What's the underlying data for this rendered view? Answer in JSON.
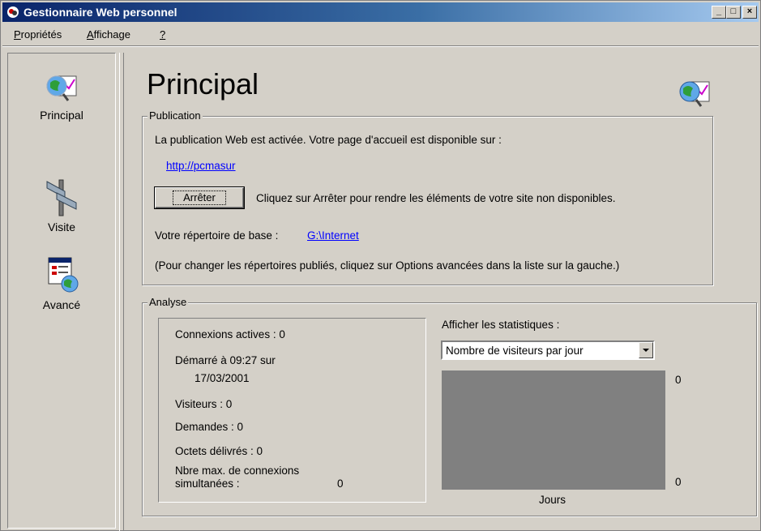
{
  "window": {
    "title": "Gestionnaire Web personnel",
    "controls": {
      "minimize": "_",
      "maximize": "□",
      "close": "×"
    }
  },
  "menu": [
    {
      "label": "Propriétés",
      "accel": "P",
      "rest": "ropriétés"
    },
    {
      "label": "Affichage",
      "accel": "A",
      "rest": "ffichage"
    },
    {
      "label": "?",
      "accel": "?",
      "rest": ""
    }
  ],
  "sidebar": {
    "items": [
      {
        "label": "Principal",
        "icon": "home-page-icon"
      },
      {
        "label": "Visite",
        "icon": "signpost-icon"
      },
      {
        "label": "Avancé",
        "icon": "advanced-options-icon"
      }
    ]
  },
  "main": {
    "title": "Principal",
    "publication": {
      "legend": "Publication",
      "status": "La publication Web est activée. Votre page d'accueil est disponible sur :",
      "url": "http://pcmasur",
      "stop_button": "Arrêter",
      "stop_hint": "Cliquez sur Arrêter pour rendre les éléments de votre site non disponibles.",
      "home_dir_label": "Votre répertoire de base :",
      "home_dir": "G:\\Internet",
      "note": "(Pour changer les répertoires publiés, cliquez sur Options avancées dans la liste sur la gauche.)"
    },
    "analysis": {
      "legend": "Analyse",
      "active_connections": "Connexions actives : 0",
      "started_line1": "Démarré à 09:27 sur",
      "started_line2": "17/03/2001",
      "visitors": "Visiteurs : 0",
      "requests": "Demandes : 0",
      "bytes": "Octets délivrés : 0",
      "max_conn_line1": "Nbre max. de connexions",
      "max_conn_line2": "simultanées :",
      "max_conn_value": "0",
      "stats_label": "Afficher les statistiques :",
      "stats_selected": "Nombre de visiteurs par jour",
      "graph_top": "0",
      "graph_bottom": "0",
      "graph_xlabel": "Jours"
    }
  },
  "colors": {
    "face": "#d4d0c8",
    "title_start": "#0a246a",
    "title_end": "#a6caf0",
    "link": "#0000ff",
    "graph": "#808080"
  }
}
